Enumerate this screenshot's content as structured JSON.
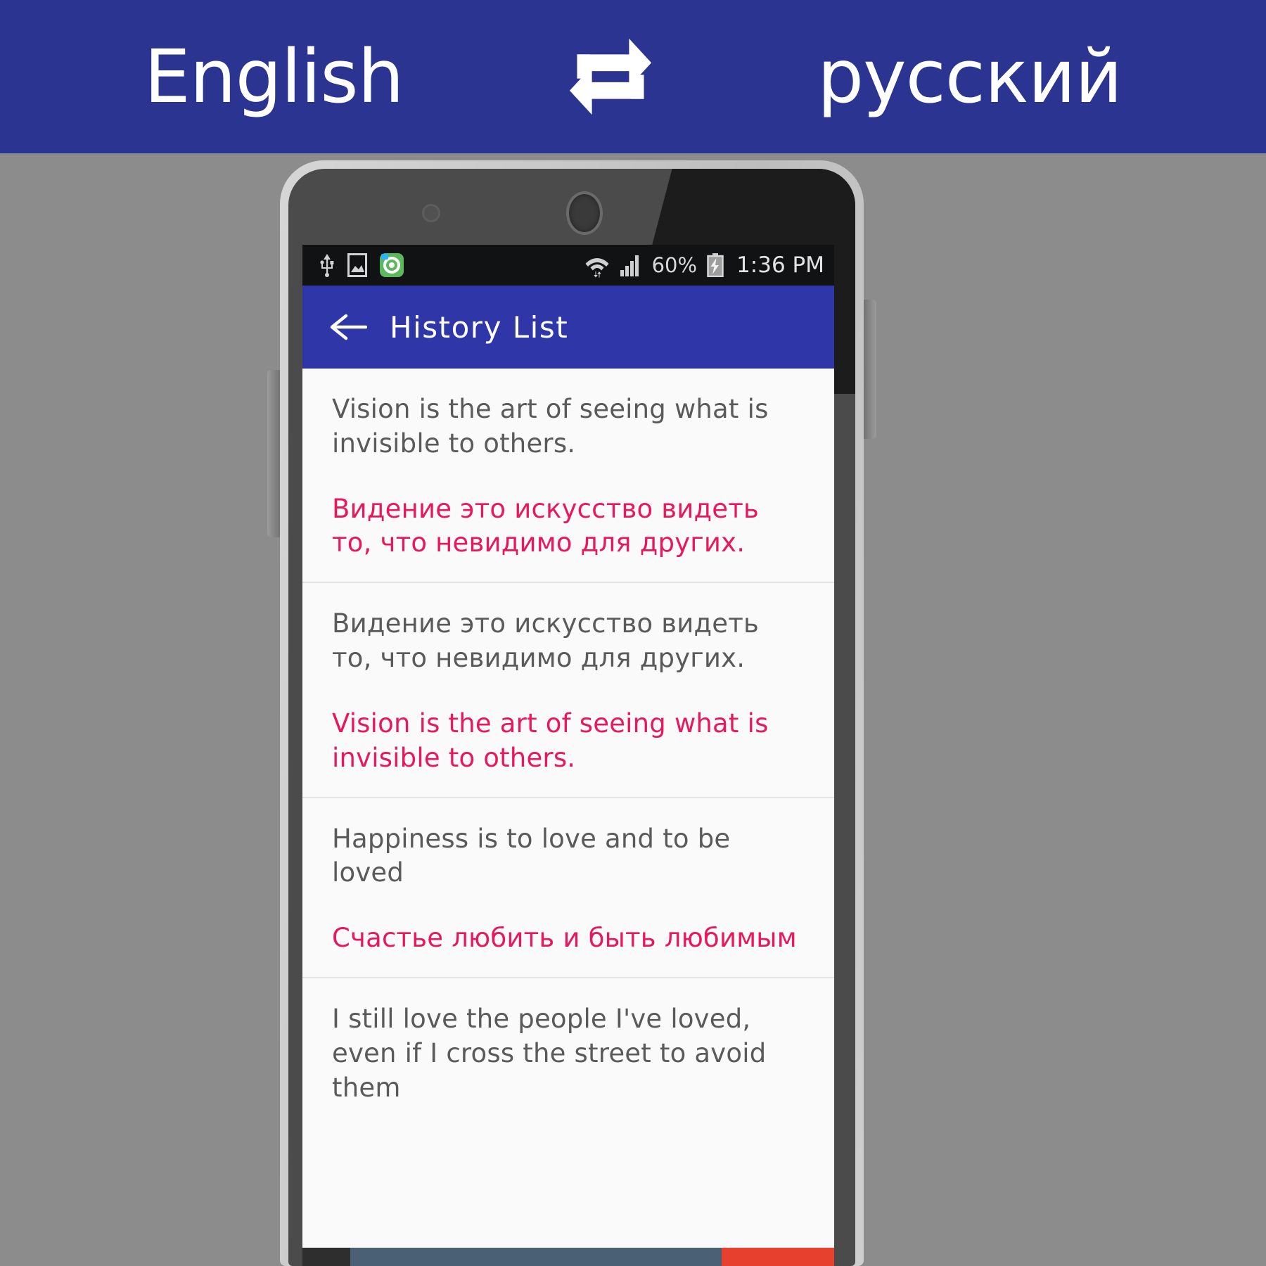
{
  "promo": {
    "source_language": "English",
    "swap_icon": "swap-repeat-icon",
    "target_language": "русский",
    "background_color": "#2b3490",
    "text_color": "#ffffff"
  },
  "phone": {
    "status_bar": {
      "background_color": "#111213",
      "left_icons": [
        "usb-icon",
        "screenshot-icon",
        "app-notification-icon"
      ],
      "wifi_icon": "wifi-transfer-icon",
      "signal_icon": "cellular-signal-icon",
      "battery_percent": "60%",
      "battery_icon": "battery-charging-icon",
      "time": "1:36 PM"
    },
    "action_bar": {
      "back_icon": "back-arrow-icon",
      "title": "History List",
      "background_color": "#2f37a8"
    },
    "history": {
      "source_color": "#5a5a5a",
      "translation_color": "#e8185d",
      "items": [
        {
          "source": "Vision is the art of seeing what is invisible to others.",
          "translation": "Видение это искусство видеть то, что невидимо для других."
        },
        {
          "source": "Видение это искусство видеть то, что невидимо для других.",
          "translation": "Vision is the art of seeing what is invisible to others."
        },
        {
          "source": "Happiness is to love and to be loved",
          "translation": "Счастье любить и быть любимым"
        },
        {
          "source": "I still love the people I've loved, even if I cross the street to avoid them",
          "translation": ""
        }
      ]
    }
  }
}
